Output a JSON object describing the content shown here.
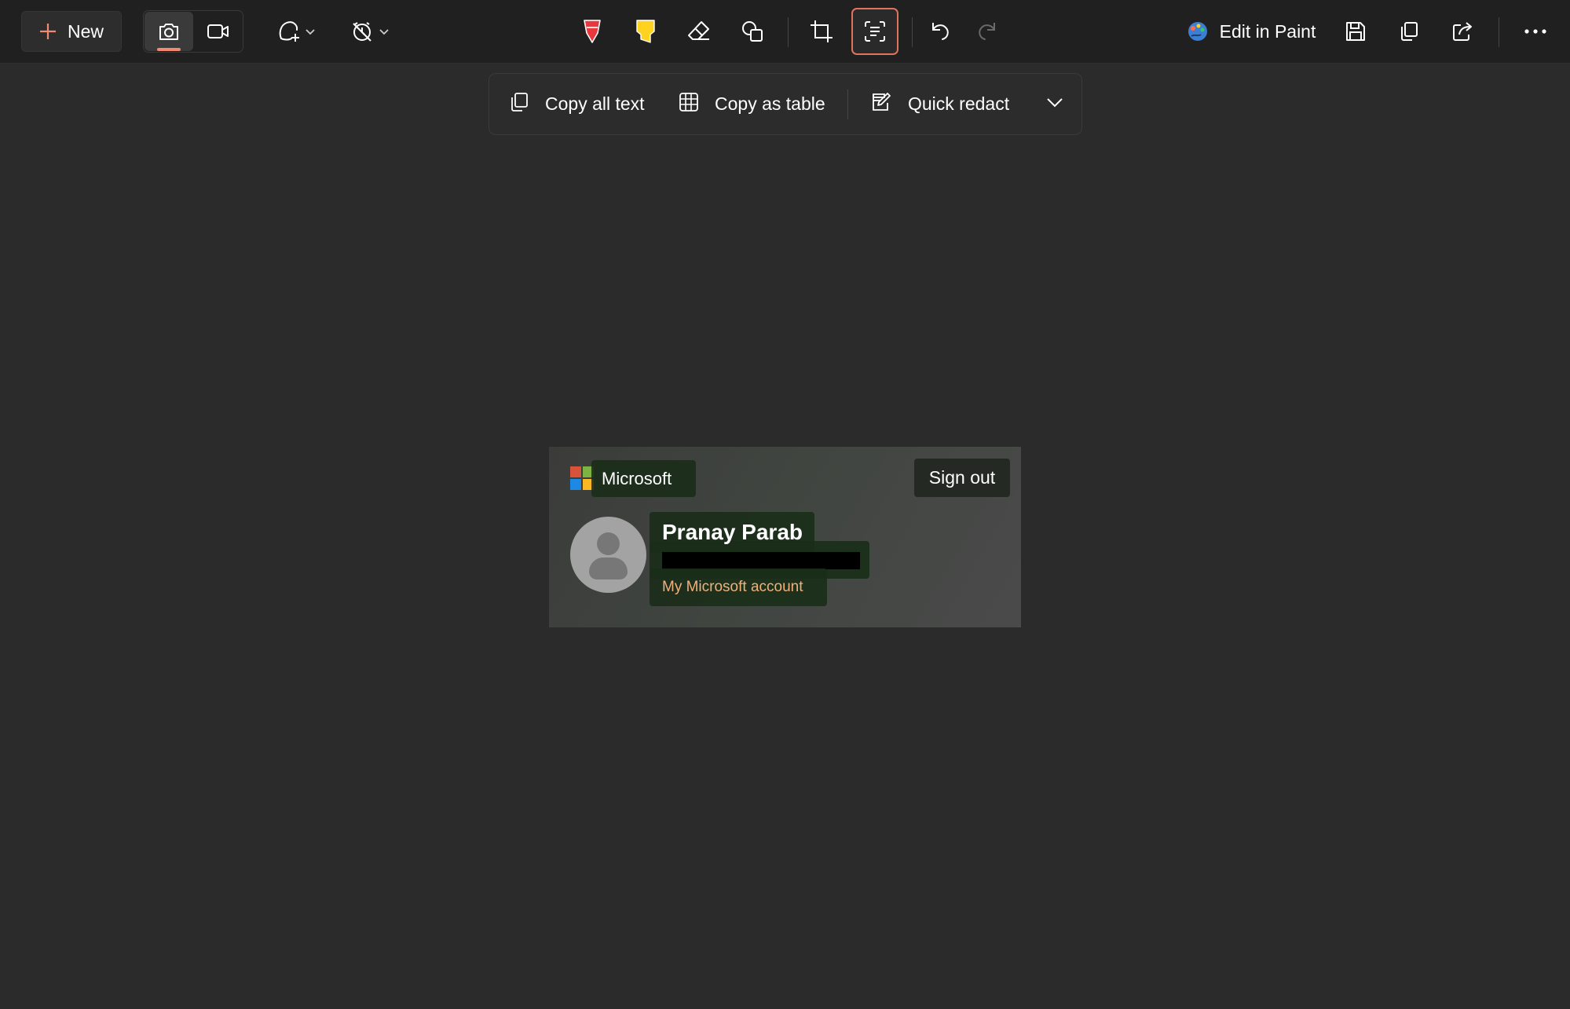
{
  "toolbar": {
    "new_label": "New",
    "edit_in_paint_label": "Edit in Paint",
    "icons": {
      "new": "plus-icon",
      "snip_mode": "camera-icon",
      "record_mode": "video-camera-icon",
      "shape": "freeform-shape-icon",
      "timer": "no-delay-timer-icon",
      "ballpoint": "ballpoint-pen-icon",
      "highlighter": "highlighter-icon",
      "eraser": "eraser-icon",
      "shapes": "shapes-icon",
      "crop": "crop-icon",
      "text_actions": "text-actions-icon",
      "undo": "undo-icon",
      "redo": "redo-icon",
      "paint": "paint-icon",
      "save": "save-icon",
      "copy": "copy-icon",
      "share": "share-icon",
      "more": "more-icon"
    }
  },
  "text_actions": {
    "copy_all_text_label": "Copy all text",
    "copy_as_table_label": "Copy as table",
    "quick_redact_label": "Quick redact"
  },
  "capture": {
    "brand": "Microsoft",
    "sign_out_label": "Sign out",
    "user_name": "Pranay Parab",
    "account_link": "My Microsoft account"
  },
  "colors": {
    "accent": "#e0735c",
    "pen_red": "#e8383d",
    "highlighter_yellow": "#ffd21f",
    "text_highlight": "#1a2e18",
    "link_orange": "#f0b27a"
  }
}
